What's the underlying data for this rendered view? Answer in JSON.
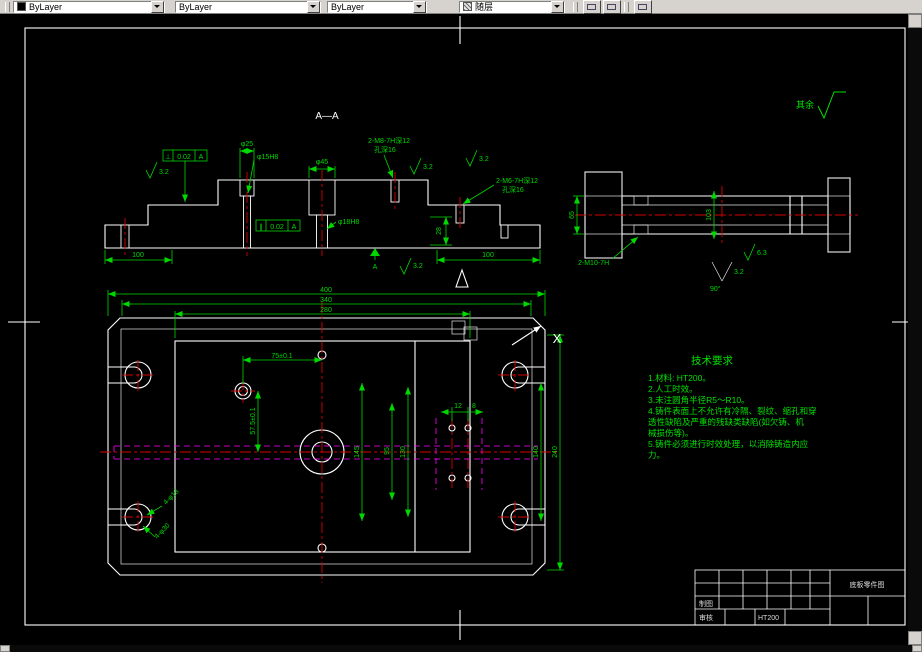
{
  "toolbar": {
    "color": "ByLayer",
    "linetype": "ByLayer",
    "lineweight": "ByLayer",
    "plotstyle": "随层"
  },
  "drawing": {
    "section_label": "A—A",
    "surface_note": "其余",
    "x_marker": "X",
    "datum": "A",
    "sec": {
      "dia25": "φ25",
      "dia15": "φ15H8",
      "dia45": "φ45",
      "dia18": "φ18H8",
      "m8_line1": "2-M8-7H深12",
      "m8_line2": "孔深16",
      "m6_line1": "2-M6-7H深12",
      "m6_line2": "孔深16",
      "gdt1_sym": "⊥",
      "gdt1_val": "0.02",
      "gdt1_datum": "A",
      "gdt2_sym": "∥",
      "gdt2_val": "0.02",
      "gdt2_datum": "A",
      "len_left": "100",
      "len_right": "100",
      "thk": "28",
      "ra1": "3.2",
      "ra2": "3.2",
      "ra3": "3.2",
      "ra4": "3.2"
    },
    "side": {
      "h65": "65",
      "h103": "103",
      "m10": "2-M10-7H",
      "ra63": "6.3",
      "ra32": "3.2",
      "angle": "90°"
    },
    "plan": {
      "w400": "400",
      "w340": "340",
      "w280": "280",
      "px75": "75±0.1",
      "py575": "57.5±0.1",
      "v145": "145",
      "v130": "130",
      "v95": "95",
      "v140": "140",
      "v240": "240",
      "s12": "12",
      "s8": "8",
      "slots": "4-φ18",
      "cbores": "4-φ30"
    },
    "tech": {
      "title": "技术要求",
      "lines": [
        "1.材料: HT200。",
        "2.人工时效。",
        "3.未注圆角半径R5～R10。",
        "4.铸件表面上不允许有冷隔、裂纹、缩孔和穿",
        "  透性缺陷及严重的残缺类缺陷(如欠铸、机",
        "  械损伤等)。",
        "5.铸件必须进行时效处理，以消除铸造内应",
        "  力。"
      ]
    },
    "titleblock": {
      "drafter_label": "制图",
      "checker_label": "审核",
      "material": "HT200",
      "title": "底板零件图"
    }
  }
}
